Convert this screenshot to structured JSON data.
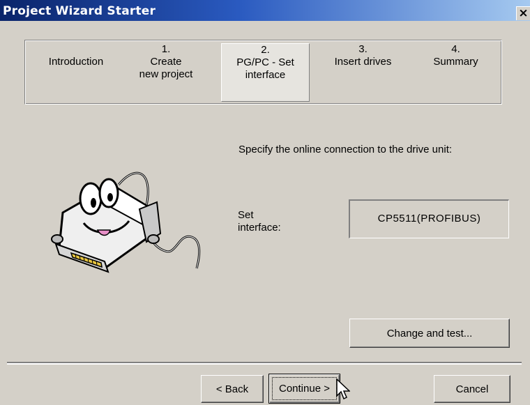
{
  "window": {
    "title": "Project Wizard Starter",
    "close_glyph": "×"
  },
  "steps": [
    {
      "number": "",
      "lines": [
        "Introduction"
      ],
      "active": false
    },
    {
      "number": "1.",
      "lines": [
        "Create",
        "new project"
      ],
      "active": false
    },
    {
      "number": "2.",
      "lines": [
        "PG/PC - Set",
        "interface"
      ],
      "active": true
    },
    {
      "number": "3.",
      "lines": [
        "Insert drives"
      ],
      "active": false
    },
    {
      "number": "4.",
      "lines": [
        "Summary"
      ],
      "active": false
    }
  ],
  "main": {
    "instruction": "Specify the online connection to the drive unit:",
    "interface_label_line1": "Set",
    "interface_label_line2": "interface:",
    "interface_value": "CP5511(PROFIBUS)",
    "change_button": "Change and test..."
  },
  "footer": {
    "back_button": "< Back",
    "continue_button": "Continue >",
    "cancel_button": "Cancel"
  },
  "illustration": {
    "icon": "interface-cable-mascot-icon"
  }
}
